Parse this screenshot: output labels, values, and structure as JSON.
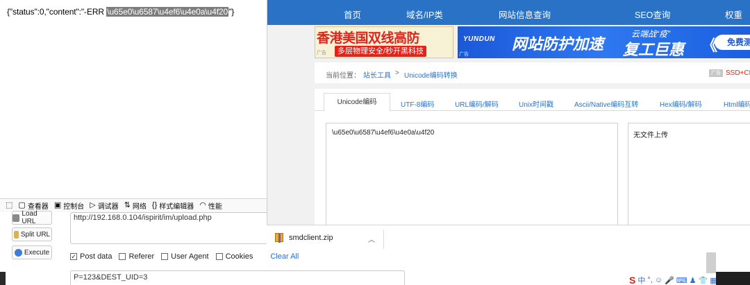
{
  "response": {
    "prefix": "{\"status\":0,\"content\":\"-ERR ",
    "selected": "\\u65e0\\u6587\\u4ef6\\u4e0a\\u4f20",
    "suffix": "\"}"
  },
  "devtools": {
    "items": [
      "查看器",
      "控制台",
      "调试器",
      "网络",
      "样式编辑器",
      "性能"
    ]
  },
  "hackbar": {
    "load_url": "Load URL",
    "split_url": "Split URL",
    "execute": "Execute",
    "url_value": "http://192.168.0.104/ispirit/im/upload.php",
    "options": {
      "post_data": "Post data",
      "referer": "Referer",
      "user_agent": "User Agent",
      "cookies": "Cookies",
      "clear_all": "Clear All"
    },
    "post_checked": true,
    "post_value": "P=123&DEST_UID=3"
  },
  "site": {
    "nav": [
      "首页",
      "域名/IP类",
      "网站信息查询",
      "SEO查询",
      "权重"
    ],
    "ad1": {
      "title": "香港美国双线高防",
      "subtitle": "多层物理安全/秒开黑科技",
      "tag": "广告"
    },
    "ad2": {
      "logo": "YUNDUN",
      "main": "网站防护加速",
      "sub1": "云端战“疫”",
      "sub2": "复工巨惠",
      "button": "免费测",
      "tag": "广告"
    },
    "breadcrumb": {
      "label": "当前位置：",
      "home": "站长工具",
      "sep": ">",
      "current": "Unicode编码转换",
      "ad_tag": "广告",
      "right_text": "SSD+CN"
    },
    "tabs": [
      "Unicode编码",
      "UTF-8编码",
      "URL编码/解码",
      "Unix时间戳",
      "Ascii/Native编码互转",
      "Hex编码/解码",
      "Html编码"
    ],
    "input_text": "\\u65e0\\u6587\\u4ef6\\u4e0a\\u4f20",
    "output_text": "无文件上传"
  },
  "download": {
    "filename": "smdclient.zip"
  },
  "colors": {
    "nav_blue": "#2a72c6",
    "accent_red": "#e2231a",
    "ad_blue": "#1b58d8"
  }
}
